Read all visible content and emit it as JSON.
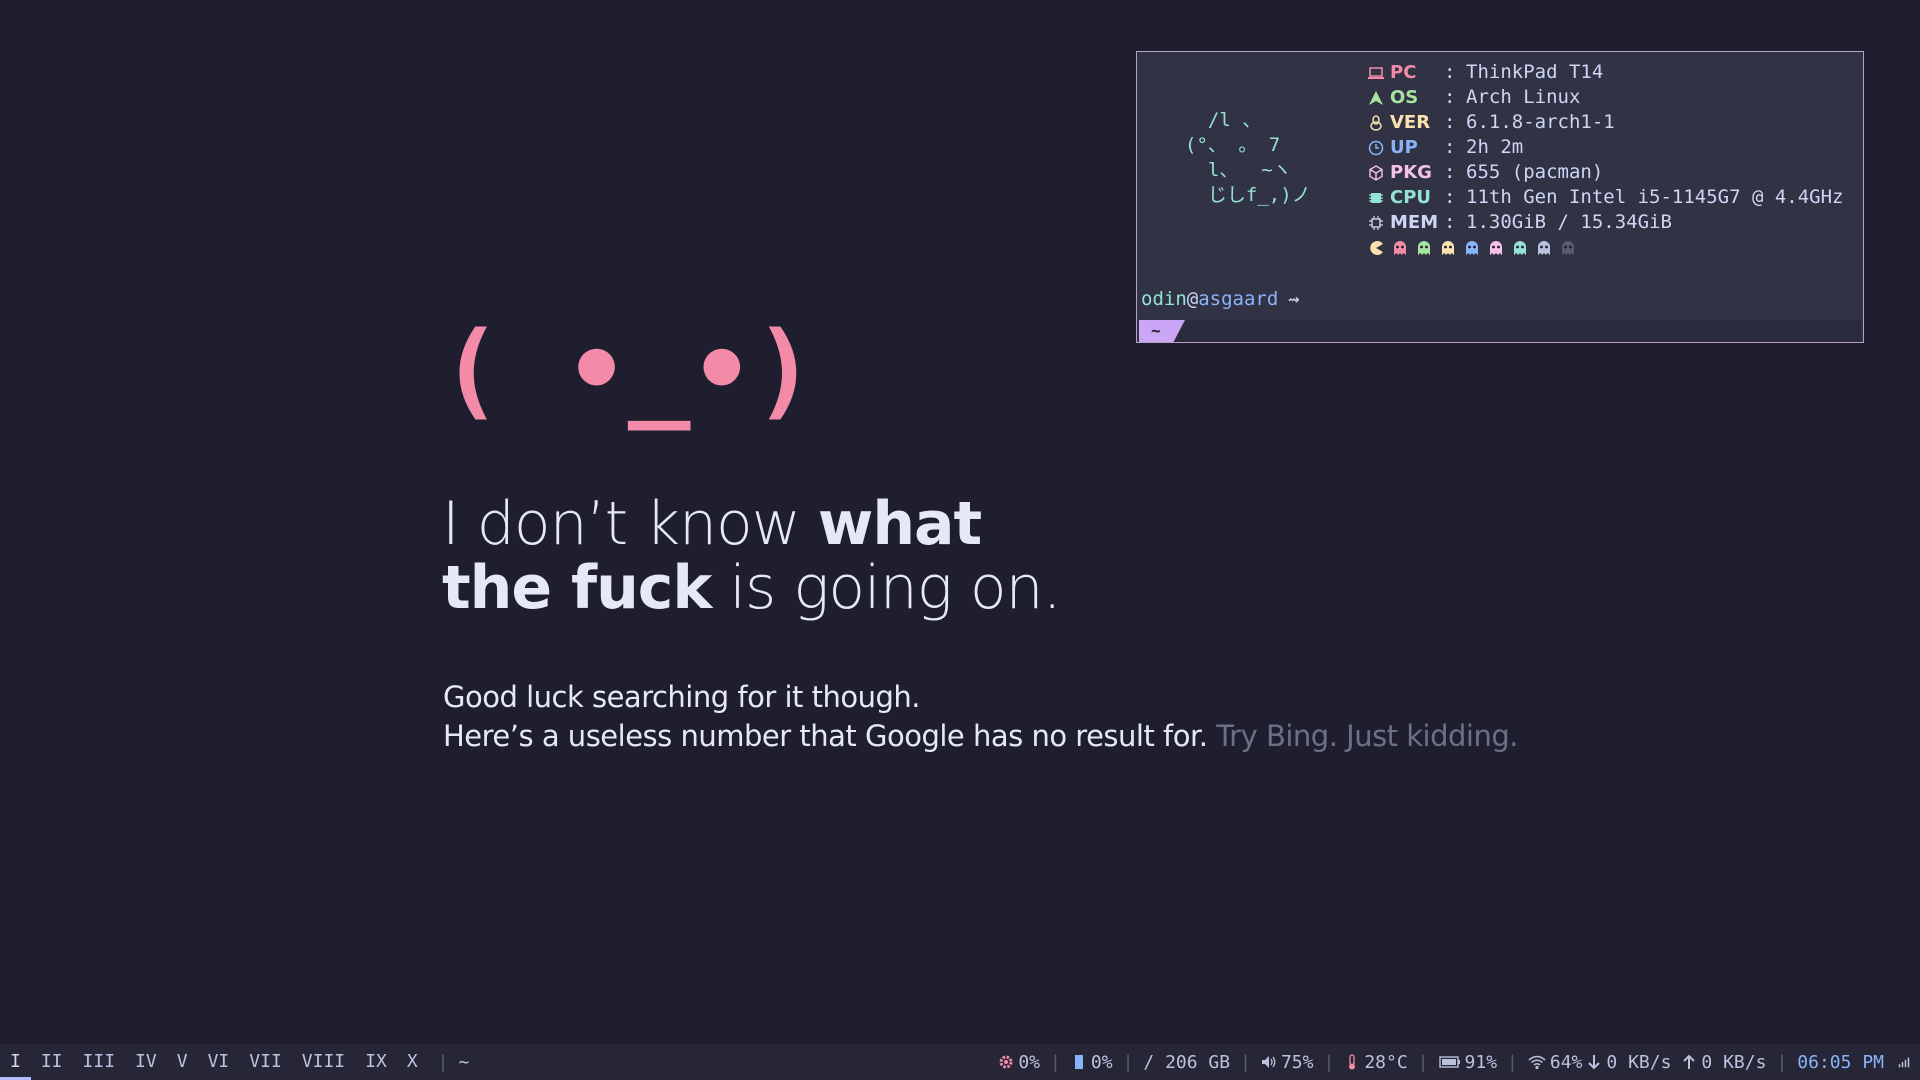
{
  "terminal": {
    "ascii_art": "  /l 、\n(°、 。 7\n  l、  ~ヽ\n  じしf_,)ノ",
    "info": [
      {
        "key": "PC",
        "value": "ThinkPad T14",
        "color": "#f38ba8",
        "icon": "laptop-icon"
      },
      {
        "key": "OS",
        "value": "Arch Linux",
        "color": "#a6e3a1",
        "icon": "arch-icon"
      },
      {
        "key": "VER",
        "value": "6.1.8-arch1-1",
        "color": "#f9e2af",
        "icon": "linux-tux-icon"
      },
      {
        "key": "UP",
        "value": "2h 2m",
        "color": "#89b4fa",
        "icon": "clock-icon"
      },
      {
        "key": "PKG",
        "value": "655 (pacman)",
        "color": "#f5c2e7",
        "icon": "package-icon"
      },
      {
        "key": "CPU",
        "value": "11th Gen Intel i5-1145G7 @ 4.4GHz",
        "color": "#94e2d5",
        "icon": "cpu-icon"
      },
      {
        "key": "MEM",
        "value": "1.30GiB / 15.34GiB",
        "color": "#cdd6f4",
        "icon": "memory-icon"
      }
    ],
    "separator": ":",
    "color_row": {
      "pacman_color": "#f9e2af",
      "ghost_colors": [
        "#f38ba8",
        "#a6e3a1",
        "#f9e2af",
        "#89b4fa",
        "#f5c2e7",
        "#94e2d5",
        "#bac2de",
        "#585b70"
      ]
    },
    "prompt": {
      "user": "odin",
      "at": "@",
      "host": "asgaard",
      "arrow": "⇝"
    },
    "tab_label": "~"
  },
  "message": {
    "face": "( •_•)",
    "headline_1_normal": "I don’t know ",
    "headline_1_bold": "what",
    "headline_2_bold": "the fuck",
    "headline_2_normal": " is going on.",
    "sub_line_1": "Good luck searching for it though.",
    "sub_line_2": "Here’s a useless number that Google has no result for.",
    "sub_line_2_dim": "Try Bing. Just kidding."
  },
  "bar": {
    "workspaces": [
      "I",
      "II",
      "III",
      "IV",
      "V",
      "VI",
      "VII",
      "VIII",
      "IX",
      "X"
    ],
    "active_workspace": "I",
    "window_title": "~",
    "status": {
      "cpu": "0%",
      "memory": "0%",
      "disk": "/ 206 GB",
      "volume": "75%",
      "temperature": "28°C",
      "battery": "91%",
      "wifi": "64%",
      "download": "0 KB/s",
      "upload": "0 KB/s",
      "time": "06:05 PM"
    },
    "colors": {
      "accent": "#b4befe",
      "cpu_icon": "#f38ba8",
      "memory_icon": "#89b4fa",
      "temp_icon": "#f38ba8"
    }
  }
}
